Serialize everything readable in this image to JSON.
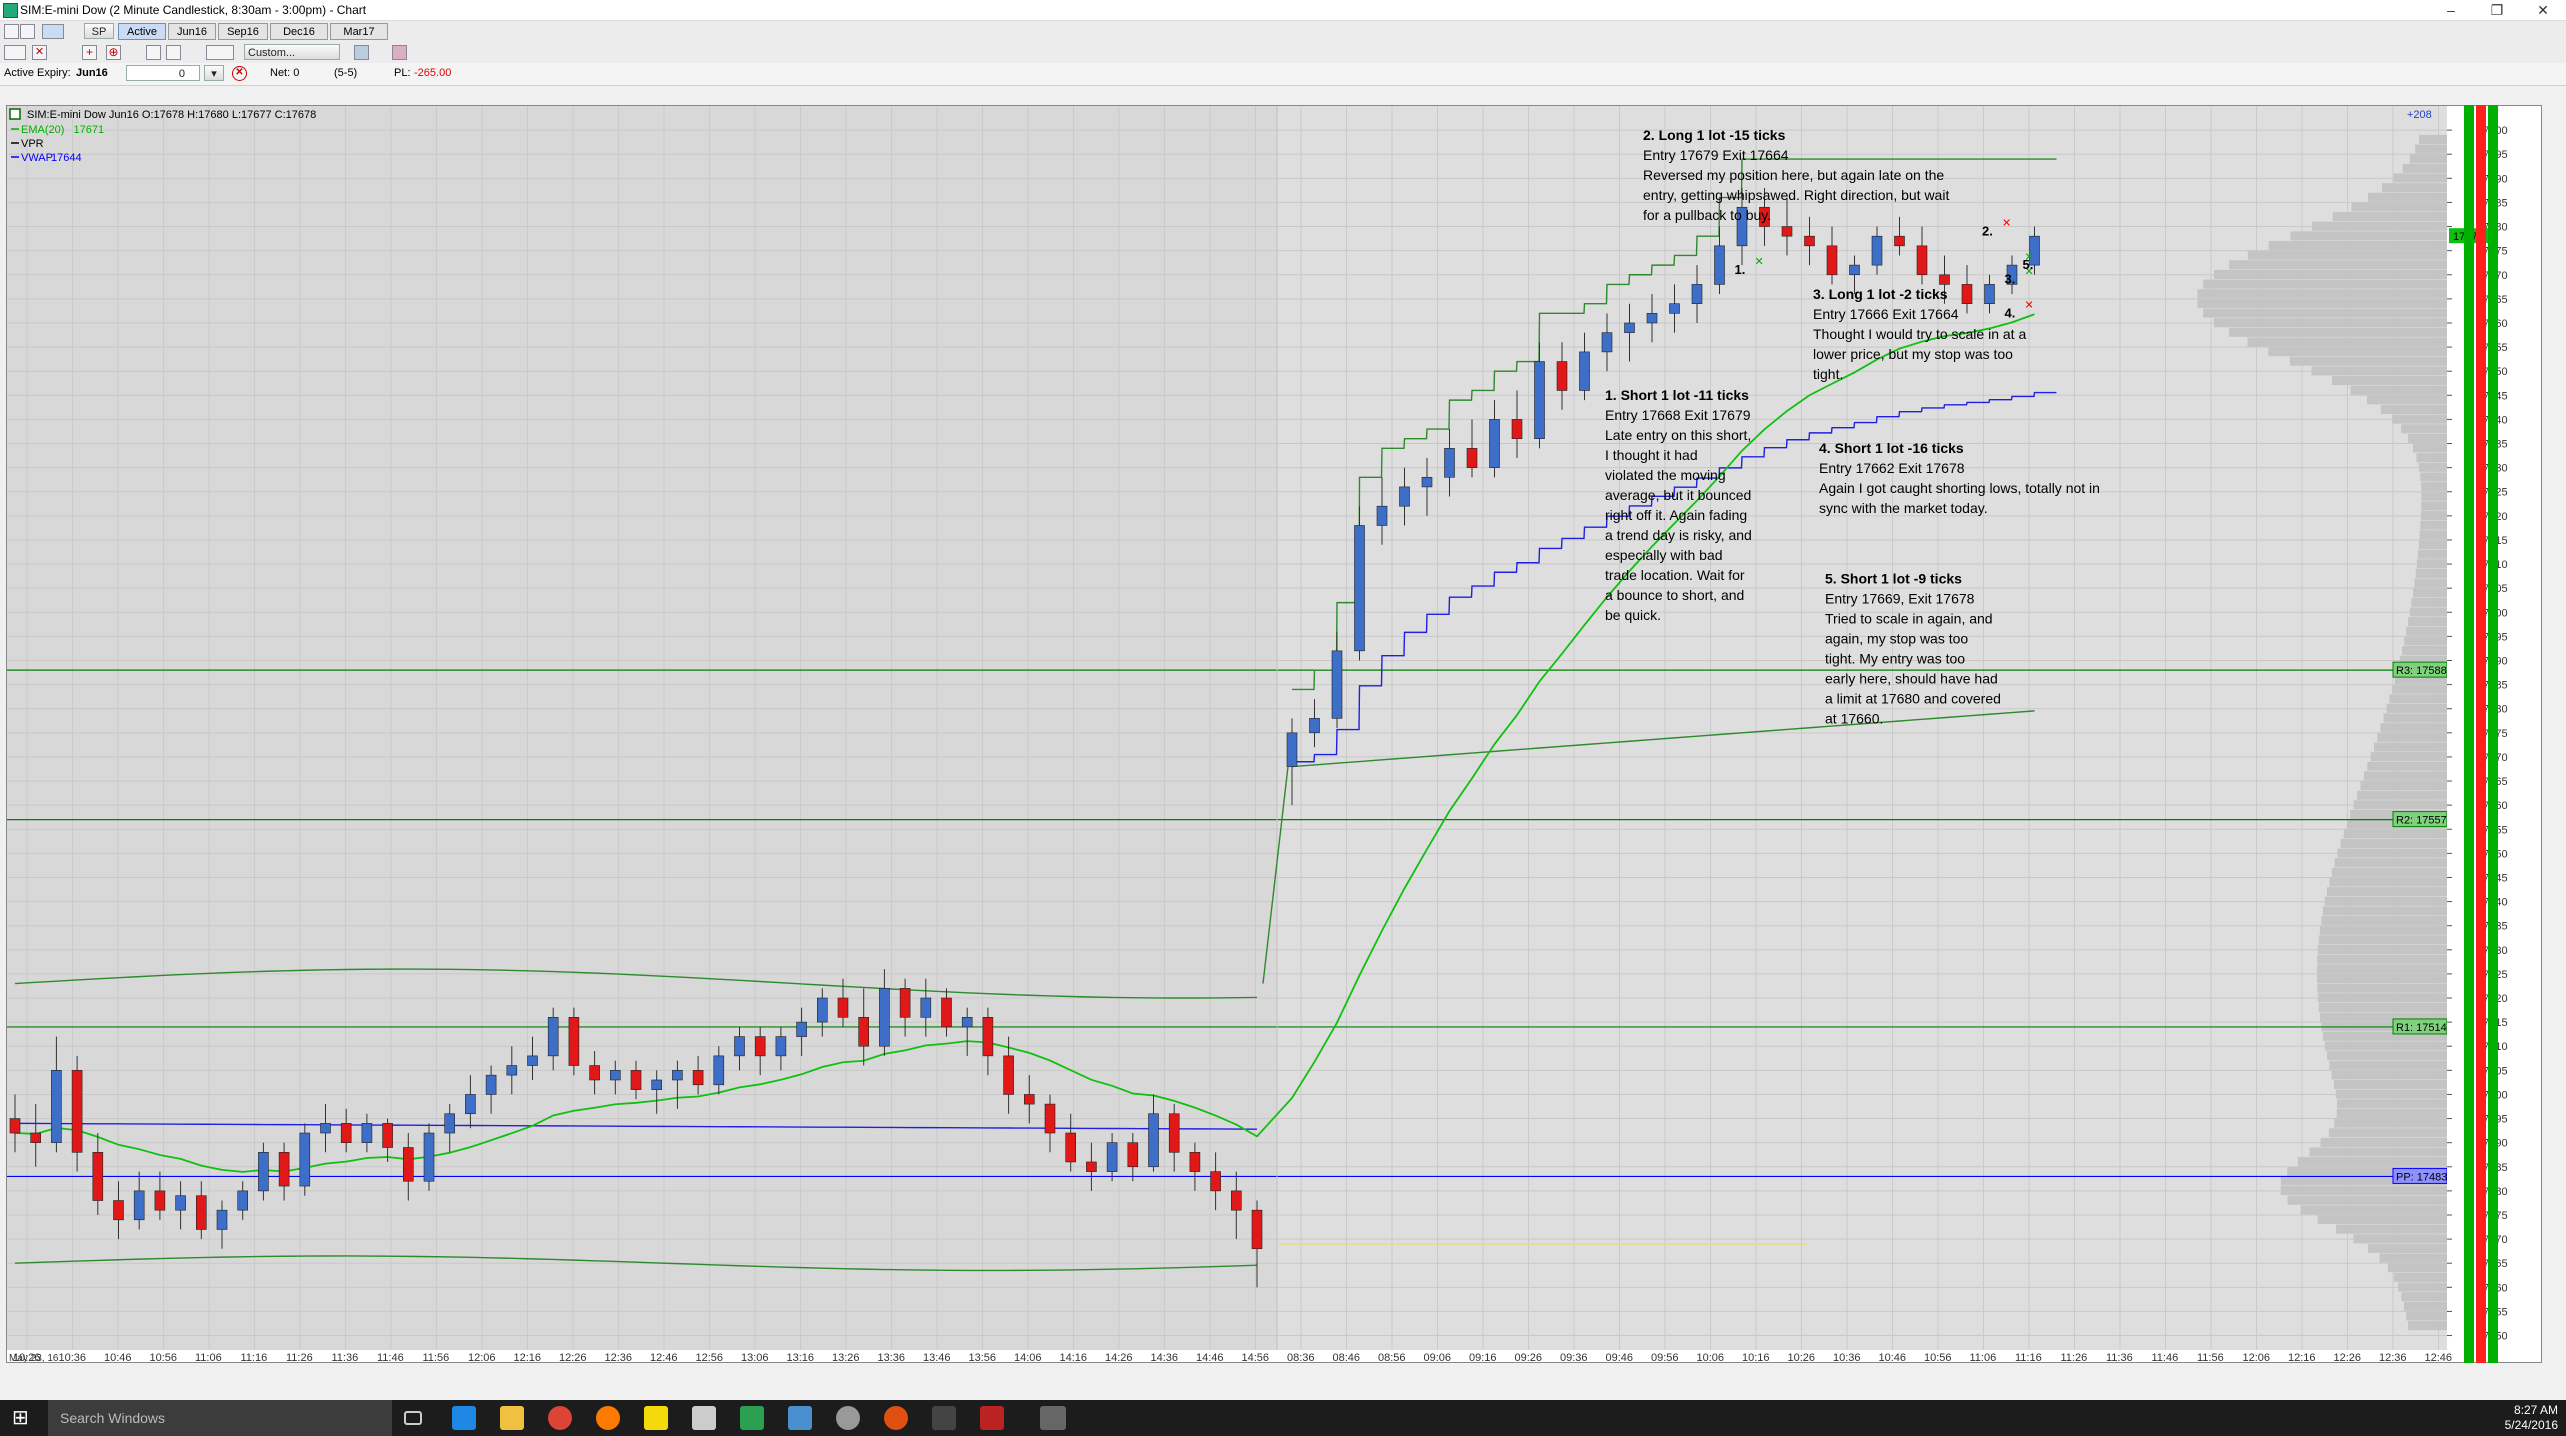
{
  "window": {
    "title": "SIM:E-mini Dow (2 Minute Candlestick, 8:30am - 3:00pm) - Chart"
  },
  "toolbar1": {
    "symbol": "SP",
    "tabs": [
      {
        "label": "Active",
        "active": true
      },
      {
        "label": "Jun16",
        "active": false
      },
      {
        "label": "Sep16",
        "active": false
      },
      {
        "label": "Dec16",
        "active": false
      },
      {
        "label": "Mar17",
        "active": false
      }
    ]
  },
  "toolbar2": {
    "template_select": "Custom..."
  },
  "toolbar3": {
    "expiry_label": "Active Expiry:",
    "expiry_value": "Jun16",
    "qty_value": "0",
    "net_label": "Net: 0",
    "range_label": "(5-5)",
    "pl_label": "PL:",
    "pl_value": "-265.00",
    "pl_color": "#e00000"
  },
  "chart_data": {
    "type": "candlestick",
    "header": "SIM:E-mini Dow Jun16 O:17678 H:17680 L:17677 C:17678",
    "date_label": "May 23, 16",
    "top_right_label": "+208",
    "legend": [
      {
        "label": "EMA(20)",
        "value": "17671",
        "color": "#00b000"
      },
      {
        "label": "VPR",
        "value": "",
        "color": "#000000"
      },
      {
        "label": "VWAP",
        "value": "17644",
        "color": "#0000ff"
      }
    ],
    "ylim": [
      17447,
      17705
    ],
    "y_ticks": [
      17450,
      17455,
      17460,
      17465,
      17470,
      17475,
      17480,
      17485,
      17490,
      17495,
      17500,
      17505,
      17510,
      17515,
      17520,
      17525,
      17530,
      17535,
      17540,
      17545,
      17550,
      17555,
      17560,
      17565,
      17570,
      17575,
      17580,
      17585,
      17590,
      17595,
      17600,
      17605,
      17610,
      17615,
      17620,
      17625,
      17630,
      17635,
      17640,
      17645,
      17650,
      17655,
      17660,
      17665,
      17670,
      17675,
      17680,
      17685,
      17690,
      17695,
      17700
    ],
    "x_ticks": [
      "10:26",
      "10:36",
      "10:46",
      "10:56",
      "11:06",
      "11:16",
      "11:26",
      "11:36",
      "11:46",
      "11:56",
      "12:06",
      "12:16",
      "12:26",
      "12:36",
      "12:46",
      "12:56",
      "13:06",
      "13:16",
      "13:26",
      "13:36",
      "13:46",
      "13:56",
      "14:06",
      "14:16",
      "14:26",
      "14:36",
      "14:46",
      "14:56",
      "08:36",
      "08:46",
      "08:56",
      "09:06",
      "09:16",
      "09:26",
      "09:36",
      "09:46",
      "09:56",
      "10:06",
      "10:16",
      "10:26",
      "10:36",
      "10:46",
      "10:56",
      "11:06",
      "11:16",
      "11:26",
      "11:36",
      "11:46",
      "11:56",
      "12:06",
      "12:16",
      "12:26",
      "12:36",
      "12:46"
    ],
    "current_price": "17678",
    "pivot_levels": [
      {
        "label": "R3: 17588",
        "value": 17588,
        "color": "#008000"
      },
      {
        "label": "R2: 17557",
        "value": 17557,
        "color": "#008000"
      },
      {
        "label": "R1: 17514",
        "value": 17514,
        "color": "#008000"
      },
      {
        "label": "PP: 17483",
        "value": 17483,
        "color": "#0000ff"
      }
    ],
    "candles": [
      [
        17495,
        17500,
        17488,
        17492
      ],
      [
        17492,
        17498,
        17485,
        17490
      ],
      [
        17490,
        17512,
        17488,
        17505
      ],
      [
        17505,
        17508,
        17484,
        17488
      ],
      [
        17488,
        17492,
        17475,
        17478
      ],
      [
        17478,
        17482,
        17470,
        17474
      ],
      [
        17474,
        17484,
        17472,
        17480
      ],
      [
        17480,
        17484,
        17474,
        17476
      ],
      [
        17476,
        17482,
        17472,
        17479
      ],
      [
        17479,
        17482,
        17470,
        17472
      ],
      [
        17472,
        17478,
        17468,
        17476
      ],
      [
        17476,
        17482,
        17474,
        17480
      ],
      [
        17480,
        17490,
        17478,
        17488
      ],
      [
        17488,
        17490,
        17478,
        17481
      ],
      [
        17481,
        17494,
        17479,
        17492
      ],
      [
        17492,
        17498,
        17488,
        17494
      ],
      [
        17494,
        17497,
        17488,
        17490
      ],
      [
        17490,
        17496,
        17488,
        17494
      ],
      [
        17494,
        17495,
        17486,
        17489
      ],
      [
        17489,
        17492,
        17478,
        17482
      ],
      [
        17482,
        17494,
        17480,
        17492
      ],
      [
        17492,
        17498,
        17488,
        17496
      ],
      [
        17496,
        17504,
        17493,
        17500
      ],
      [
        17500,
        17506,
        17496,
        17504
      ],
      [
        17504,
        17510,
        17500,
        17506
      ],
      [
        17506,
        17512,
        17503,
        17508
      ],
      [
        17508,
        17518,
        17505,
        17516
      ],
      [
        17516,
        17518,
        17504,
        17506
      ],
      [
        17506,
        17509,
        17500,
        17503
      ],
      [
        17503,
        17507,
        17500,
        17505
      ],
      [
        17505,
        17507,
        17499,
        17501
      ],
      [
        17501,
        17505,
        17496,
        17503
      ],
      [
        17503,
        17507,
        17497,
        17505
      ],
      [
        17505,
        17508,
        17500,
        17502
      ],
      [
        17502,
        17510,
        17500,
        17508
      ],
      [
        17508,
        17514,
        17505,
        17512
      ],
      [
        17512,
        17514,
        17504,
        17508
      ],
      [
        17508,
        17514,
        17505,
        17512
      ],
      [
        17512,
        17518,
        17508,
        17515
      ],
      [
        17515,
        17522,
        17512,
        17520
      ],
      [
        17520,
        17524,
        17514,
        17516
      ],
      [
        17516,
        17522,
        17506,
        17510
      ],
      [
        17510,
        17526,
        17508,
        17522
      ],
      [
        17522,
        17524,
        17512,
        17516
      ],
      [
        17516,
        17524,
        17512,
        17520
      ],
      [
        17520,
        17522,
        17512,
        17514
      ],
      [
        17514,
        17518,
        17508,
        17516
      ],
      [
        17516,
        17518,
        17504,
        17508
      ],
      [
        17508,
        17512,
        17496,
        17500
      ],
      [
        17500,
        17504,
        17494,
        17498
      ],
      [
        17498,
        17500,
        17488,
        17492
      ],
      [
        17492,
        17496,
        17484,
        17486
      ],
      [
        17486,
        17490,
        17480,
        17484
      ],
      [
        17484,
        17492,
        17482,
        17490
      ],
      [
        17490,
        17492,
        17482,
        17485
      ],
      [
        17485,
        17500,
        17484,
        17496
      ],
      [
        17496,
        17498,
        17484,
        17488
      ],
      [
        17488,
        17490,
        17480,
        17484
      ],
      [
        17484,
        17488,
        17476,
        17480
      ],
      [
        17480,
        17484,
        17470,
        17476
      ],
      [
        17476,
        17478,
        17460,
        17468
      ],
      [
        17568,
        17578,
        17560,
        17575
      ],
      [
        17575,
        17582,
        17572,
        17578
      ],
      [
        17578,
        17596,
        17576,
        17592
      ],
      [
        17592,
        17622,
        17590,
        17618
      ],
      [
        17618,
        17628,
        17614,
        17622
      ],
      [
        17622,
        17630,
        17618,
        17626
      ],
      [
        17626,
        17632,
        17620,
        17628
      ],
      [
        17628,
        17638,
        17624,
        17634
      ],
      [
        17634,
        17640,
        17628,
        17630
      ],
      [
        17630,
        17644,
        17628,
        17640
      ],
      [
        17640,
        17646,
        17632,
        17636
      ],
      [
        17636,
        17656,
        17634,
        17652
      ],
      [
        17652,
        17656,
        17642,
        17646
      ],
      [
        17646,
        17658,
        17644,
        17654
      ],
      [
        17654,
        17662,
        17650,
        17658
      ],
      [
        17658,
        17664,
        17652,
        17660
      ],
      [
        17660,
        17666,
        17656,
        17662
      ],
      [
        17662,
        17668,
        17658,
        17664
      ],
      [
        17664,
        17672,
        17660,
        17668
      ],
      [
        17668,
        17680,
        17666,
        17676
      ],
      [
        17676,
        17688,
        17672,
        17684
      ],
      [
        17684,
        17688,
        17676,
        17680
      ],
      [
        17680,
        17686,
        17674,
        17678
      ],
      [
        17678,
        17682,
        17672,
        17676
      ],
      [
        17676,
        17680,
        17668,
        17670
      ],
      [
        17670,
        17674,
        17666,
        17672
      ],
      [
        17672,
        17680,
        17670,
        17678
      ],
      [
        17678,
        17682,
        17674,
        17676
      ],
      [
        17676,
        17680,
        17668,
        17670
      ],
      [
        17670,
        17674,
        17664,
        17668
      ],
      [
        17668,
        17672,
        17662,
        17664
      ],
      [
        17664,
        17670,
        17662,
        17668
      ],
      [
        17668,
        17674,
        17666,
        17672
      ],
      [
        17672,
        17680,
        17670,
        17678
      ]
    ],
    "trade_notes": [
      {
        "title": "1. Short 1 lot -11 ticks",
        "lines": [
          "Entry 17668 Exit 17679",
          "Late entry on this short,",
          "I thought it had",
          "violated the moving",
          "average, but it bounced",
          "right off it. Again fading",
          "a trend day is risky, and",
          "especially with bad",
          "trade location. Wait for",
          "a bounce to short, and",
          "be quick."
        ]
      },
      {
        "title": "2. Long 1 lot -15 ticks",
        "lines": [
          "Entry 17679 Exit 17664",
          "Reversed my position here, but again late on the",
          "entry, getting whipsawed. Right direction, but wait",
          "for a pullback to buy."
        ]
      },
      {
        "title": "3. Long 1 lot -2 ticks",
        "lines": [
          "Entry 17666 Exit 17664",
          "Thought I would try to scale in at a",
          "lower price, but my stop was too",
          "tight."
        ]
      },
      {
        "title": "4. Short 1 lot -16 ticks",
        "lines": [
          "Entry 17662 Exit 17678",
          "Again I got caught shorting lows, totally not in",
          "sync with the market today."
        ]
      },
      {
        "title": "5. Short 1 lot -9 ticks",
        "lines": [
          "Entry 17669, Exit 17678",
          "Tried to scale in again, and",
          "again, my stop was too",
          "tight. My entry was too",
          "early here, should have had",
          "a limit at 17680 and covered",
          "at 17660."
        ]
      }
    ],
    "marker_labels": [
      "1.",
      "2.",
      "3.",
      "4.",
      "5."
    ]
  },
  "taskbar": {
    "search_placeholder": "Search Windows",
    "time": "8:27 AM",
    "date": "5/24/2016"
  }
}
